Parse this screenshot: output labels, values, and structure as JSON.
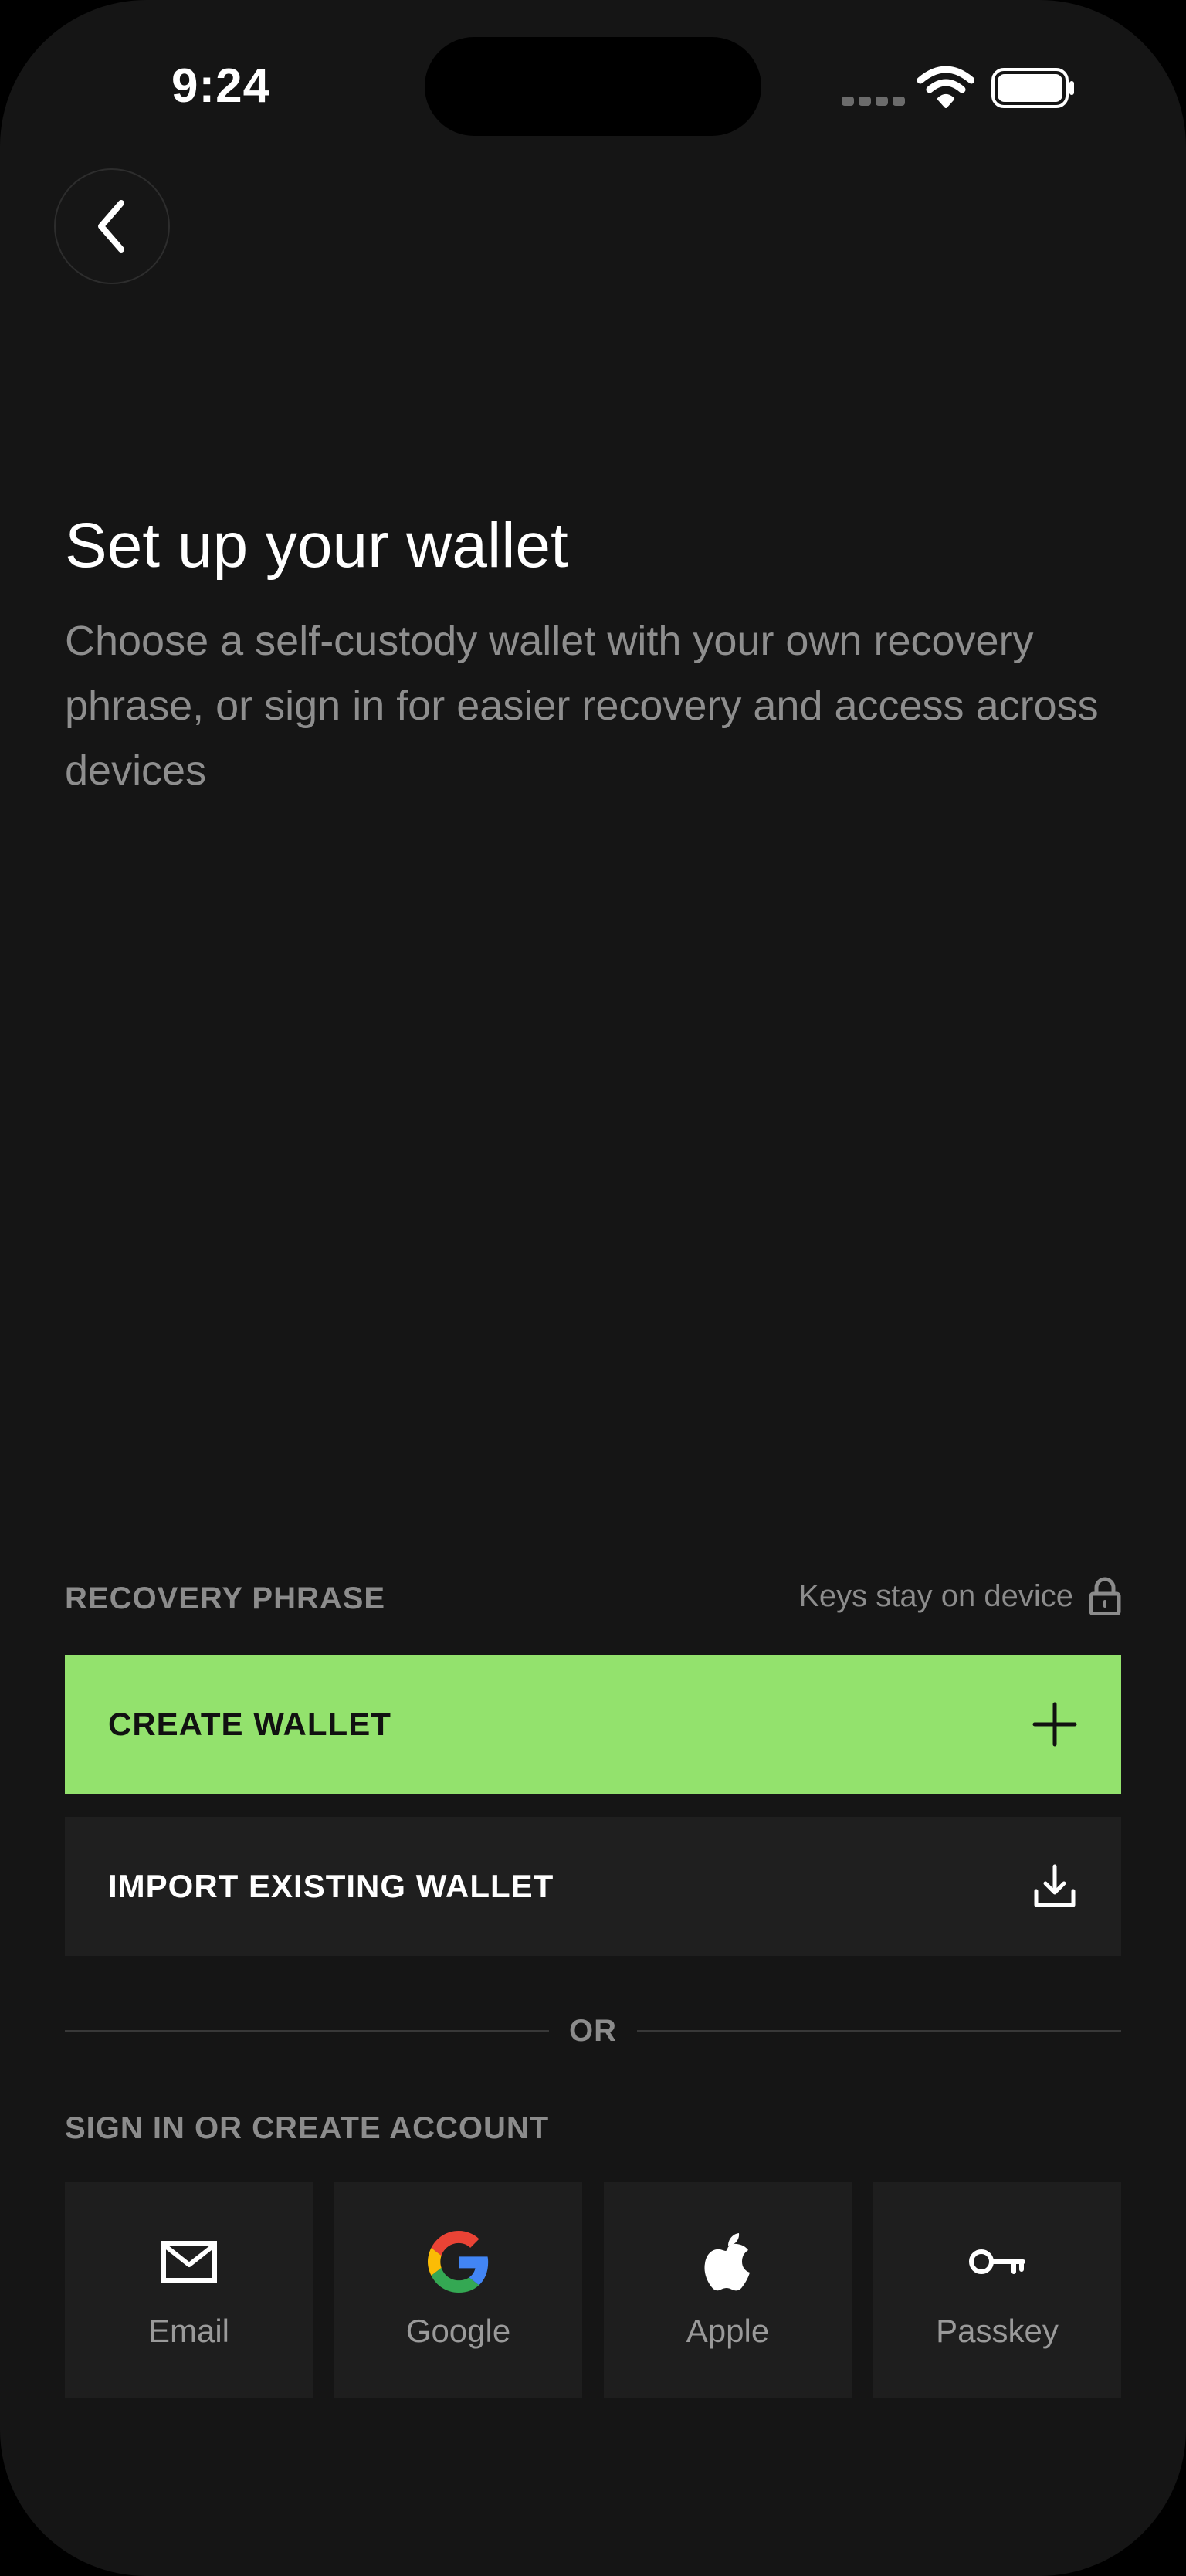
{
  "status_bar": {
    "time": "9:24"
  },
  "header": {
    "title": "Set up your wallet",
    "subtitle": "Choose a self-custody wallet with your own recovery phrase, or sign in for easier recovery and access across devices"
  },
  "recovery": {
    "section_label": "RECOVERY PHRASE",
    "keys_note": "Keys stay on device",
    "create_label": "CREATE WALLET",
    "import_label": "IMPORT EXISTING WALLET"
  },
  "divider": {
    "text": "OR"
  },
  "sign_in": {
    "section_label": "SIGN IN OR CREATE ACCOUNT",
    "providers": [
      {
        "label": "Email",
        "icon": "mail-icon"
      },
      {
        "label": "Google",
        "icon": "google-icon"
      },
      {
        "label": "Apple",
        "icon": "apple-icon"
      },
      {
        "label": "Passkey",
        "icon": "key-icon"
      }
    ]
  },
  "colors": {
    "accent": "#93E26D",
    "background": "#151515",
    "button_dark": "#1F1F1F"
  }
}
